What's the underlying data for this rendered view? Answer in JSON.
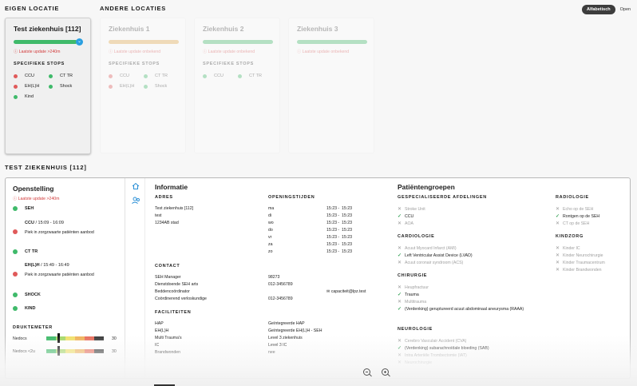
{
  "header": {
    "own_title": "EIGEN LOCATIE",
    "other_title": "ANDERE LOCATIES"
  },
  "sort_toggle": {
    "active": "Alfabetisch",
    "inactive": "Open"
  },
  "own_card": {
    "title": "Test ziekenhuis [112]",
    "warning": "Laatste update >240m",
    "stops_title": "SPECIFIEKE STOPS",
    "stops": [
      {
        "label": "CCU",
        "status": "red"
      },
      {
        "label": "CT TR",
        "status": "green"
      },
      {
        "label": "EH(L)H",
        "status": "red"
      },
      {
        "label": "Shock",
        "status": "green"
      },
      {
        "label": "Kind",
        "status": "green"
      }
    ]
  },
  "other_cards": [
    {
      "title": "Ziekenhuis 1",
      "bar_color": "#e3a94a",
      "warning": "Laatste update onbekend",
      "stops_title": "SPECIFIEKE STOPS",
      "stops": [
        {
          "label": "CCU",
          "status": "red"
        },
        {
          "label": "CT TR",
          "status": "green"
        },
        {
          "label": "EH(L)H",
          "status": "red"
        },
        {
          "label": "Shock",
          "status": "green"
        }
      ]
    },
    {
      "title": "Ziekenhuis 2",
      "bar_color": "#3fba6a",
      "warning": "Laatste update onbekend",
      "stops_title": "SPECIFIEKE STOPS",
      "stops": [
        {
          "label": "CCU",
          "status": "green"
        },
        {
          "label": "CT TR",
          "status": "green"
        }
      ]
    },
    {
      "title": "Ziekenhuis 3",
      "bar_color": "#3fba6a",
      "warning": "Laatste update onbekend",
      "stops_title": "",
      "stops": []
    }
  ],
  "detail_title": "TEST ZIEKENHUIS [112]",
  "openstelling": {
    "title": "Openstelling",
    "warning": "Laatste update >240m",
    "items": [
      {
        "label": "SEH",
        "status": "green",
        "meta": "",
        "note": ""
      },
      {
        "label": "CCU",
        "status": "red",
        "meta": " / 15:09 - 16:09",
        "note": "Piek in zorgzwaarte patiënten aanbod"
      },
      {
        "label": "CT TR",
        "status": "green",
        "meta": "",
        "note": ""
      },
      {
        "label": "EH(L)H",
        "status": "red",
        "meta": " / 15:49 - 16:49",
        "note": "Piek in zorgzwaarte patiënten aanbod"
      },
      {
        "label": "SHOCK",
        "status": "green",
        "meta": "",
        "note": ""
      },
      {
        "label": "KIND",
        "status": "green",
        "meta": "",
        "note": ""
      }
    ],
    "druktemeter_title": "DRUKTEMETER",
    "meters": [
      {
        "label": "Nedocs",
        "value": "30",
        "level": 0.2
      },
      {
        "label": "Nedocs <2u",
        "value": "30",
        "level": 0.2
      }
    ]
  },
  "informatie": {
    "title": "Informatie",
    "adres_title": "ADRES",
    "adres": [
      "Test ziekenhuis [112]",
      "test",
      "1234AB stad"
    ],
    "openingstijden_title": "OPENINGSTIJDEN",
    "openingstijden": [
      {
        "day": "ma",
        "time": "15:23 -  15:23"
      },
      {
        "day": "di",
        "time": "15:23 -  15:23"
      },
      {
        "day": "wo",
        "time": "15:23 -  15:23"
      },
      {
        "day": "do",
        "time": "15:23 -  15:23"
      },
      {
        "day": "vr",
        "time": "15:23 -  15:23"
      },
      {
        "day": "za",
        "time": "15:23 -  15:23"
      },
      {
        "day": "zo",
        "time": "15:23 -  15:23"
      }
    ],
    "contact_title": "CONTACT",
    "contact": [
      {
        "label": "SEH Manager",
        "value": "98273"
      },
      {
        "label": "Dienstdoende SEH arts",
        "value": "012-3456789"
      },
      {
        "label": "Beddencoördinator",
        "value": ""
      },
      {
        "label": "Coördinerend verloskundige",
        "value": "012-3456789"
      }
    ],
    "email": "capaciteit@lpz.test",
    "faciliteiten_title": "FACILITEITEN",
    "faciliteiten": [
      {
        "label": "HAP",
        "value": "Geïntegreerde HAP"
      },
      {
        "label": "EH(L)H",
        "value": "Geïntegreerde EH(L)H - SEH"
      },
      {
        "label": "Multi Trauma's",
        "value": "Level 3 ziekenhuis"
      },
      {
        "label": "IC",
        "value": "Level 3 IC"
      },
      {
        "label": "Brandwonden",
        "value": "nee"
      }
    ]
  },
  "patientengroepen": {
    "title": "Patiëntengroepen",
    "groups_left": [
      {
        "title": "GESPECIALISEERDE AFDELINGEN",
        "items": [
          {
            "label": "Stroke Unit",
            "ok": false
          },
          {
            "label": "CCU",
            "ok": true
          },
          {
            "label": "AOA",
            "ok": false
          }
        ]
      },
      {
        "title": "CARDIOLOGIE",
        "items": [
          {
            "label": "Acuut Myocard Infarct (AMI)",
            "ok": false
          },
          {
            "label": "Left Ventricular Assist Device (LVAD)",
            "ok": true
          },
          {
            "label": "Acuut coronair syndroom (ACS)",
            "ok": false
          }
        ]
      },
      {
        "title": "CHIRURGIE",
        "items": [
          {
            "label": "Heupfractuur",
            "ok": false
          },
          {
            "label": "Trauma",
            "ok": true
          },
          {
            "label": "Multitrauma",
            "ok": false
          },
          {
            "label": "(Verdenking) geruptureerd acuut abdominaal aneurysma (RAAA)",
            "ok": true
          }
        ]
      },
      {
        "title": "NEUROLOGIE",
        "items": [
          {
            "label": "Cerebro Vasculair Accident (CVA)",
            "ok": false
          },
          {
            "label": "(Verdenking) subarachnoïdale bloeding (SAB)",
            "ok": true
          },
          {
            "label": "Intra Arteriële Trombectomie (IAT)",
            "ok": false
          },
          {
            "label": "Neurochirurgie",
            "ok": false
          }
        ]
      }
    ],
    "groups_right": [
      {
        "title": "RADIOLOGIE",
        "items": [
          {
            "label": "Echo op de SEH",
            "ok": false
          },
          {
            "label": "Rontgen op de SEH",
            "ok": true
          },
          {
            "label": "CT op de SEH",
            "ok": false
          }
        ]
      },
      {
        "title": "KINDZORG",
        "items": [
          {
            "label": "Kinder IC",
            "ok": false
          },
          {
            "label": "Kinder Neurochirurgie",
            "ok": false
          },
          {
            "label": "Kinder Traumacentrum",
            "ok": false
          },
          {
            "label": "Kinder Brandwonden",
            "ok": false
          }
        ]
      }
    ]
  }
}
